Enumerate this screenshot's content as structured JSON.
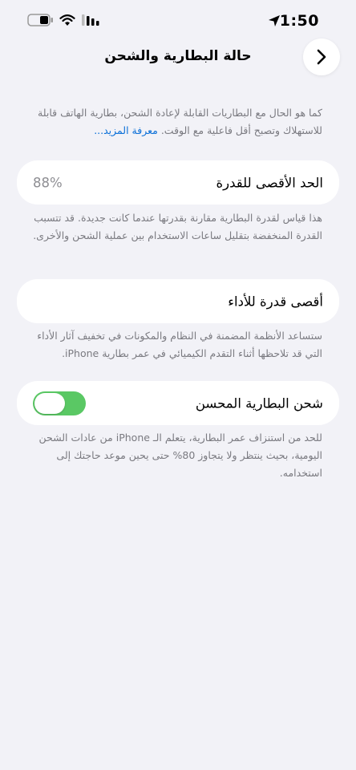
{
  "status_bar": {
    "time": "1:50"
  },
  "nav": {
    "title": "حالة البطارية والشحن"
  },
  "intro": {
    "text": "كما هو الحال مع البطاريات القابلة لإعادة الشحن، بطارية الهاتف قابلة للاستهلاك وتصبح أقل فاعلية مع الوقت. ",
    "link": "معرفة المزيد..."
  },
  "max_capacity": {
    "label": "الحد الأقصى للقدرة",
    "value": "88%",
    "footnote": "هذا قياس لقدرة البطارية مقارنة بقدرتها عندما كانت جديدة. قد تتسبب القدرة المنخفضة بتقليل ساعات الاستخدام بين عملية الشحن والأخرى."
  },
  "peak_performance": {
    "label": "أقصى قدرة للأداء",
    "footnote": "ستساعد الأنظمة المضمنة في النظام والمكونات في تخفيف آثار الأداء التي قد تلاحظها أثناء التقدم الكيميائي في عمر بطارية iPhone."
  },
  "optimized_charging": {
    "label": "شحن البطارية المحسن",
    "enabled": true,
    "footnote": "للحد من استنزاف عمر البطارية، يتعلم الـ iPhone من عادات الشحن اليومية، بحيث ينتظر ولا يتجاوز 80% حتى يحين موعد حاجتك إلى استخدامه."
  },
  "colors": {
    "accent": "#0a6fd8",
    "toggle_on": "#5ac864",
    "background": "#f2f2f7"
  }
}
